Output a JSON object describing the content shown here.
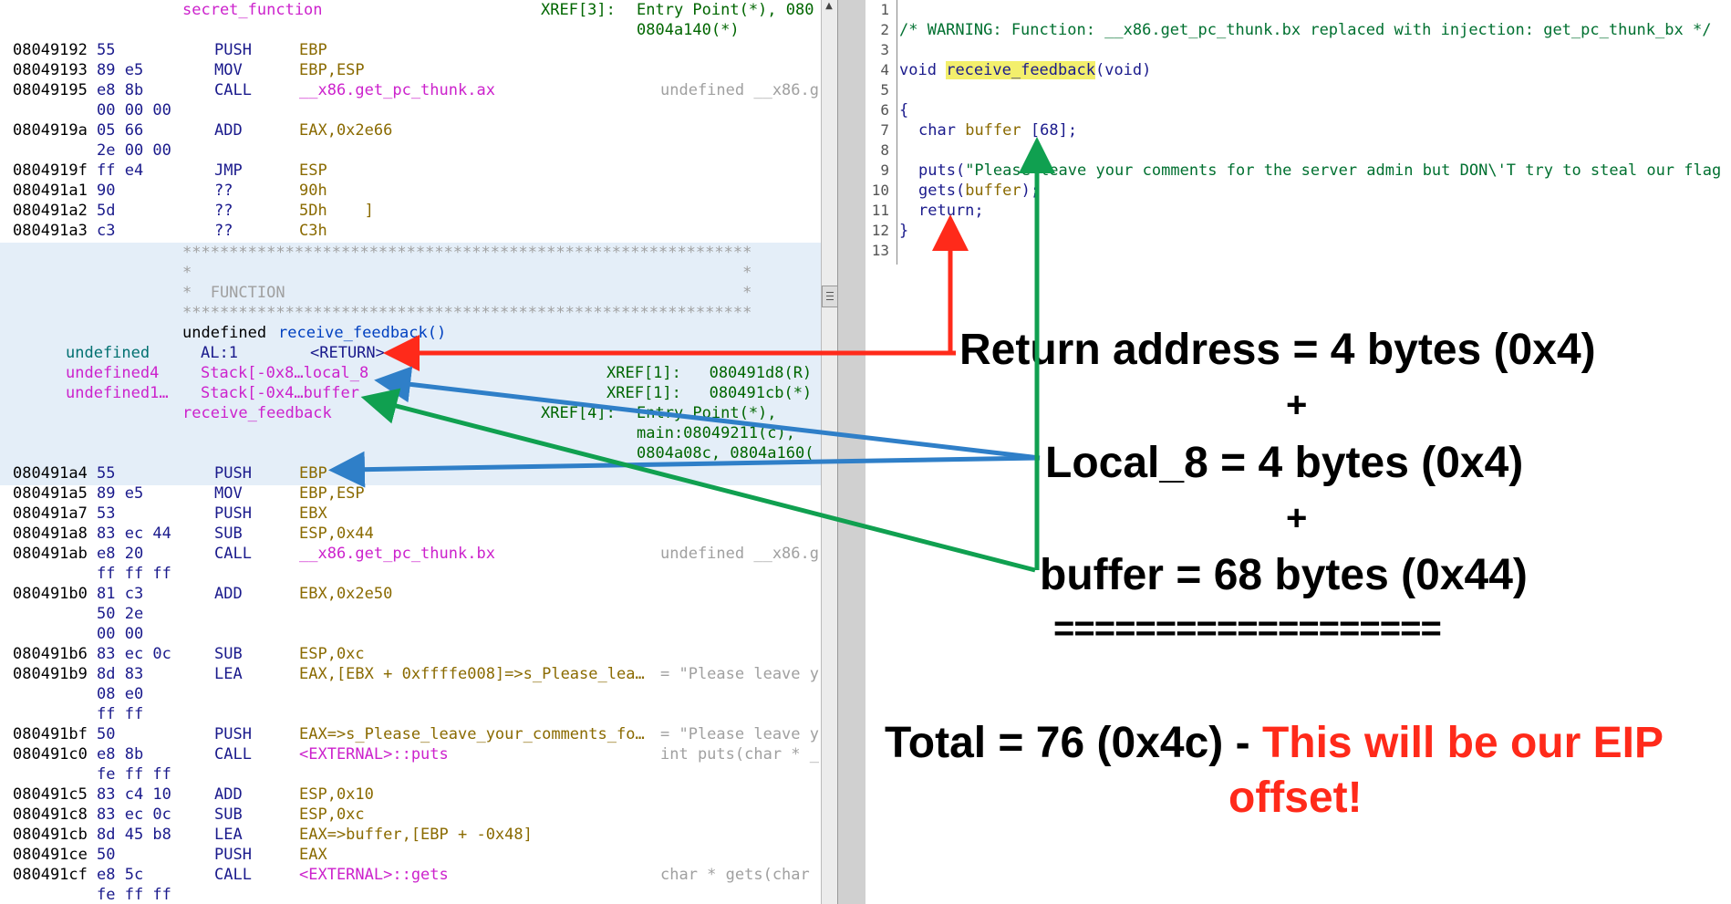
{
  "listing": {
    "header": {
      "func_name": "secret_function",
      "xref_label": "XREF[3]:",
      "xref_entry": "Entry Point(*), 080",
      "xref_cont": "0804a140(*)"
    },
    "rows_top": [
      {
        "addr": "08049192",
        "bytes": "55",
        "mnem": "PUSH",
        "op": "EBP"
      },
      {
        "addr": "08049193",
        "bytes": "89 e5",
        "mnem": "MOV",
        "op": "EBP,ESP"
      },
      {
        "addr": "08049195",
        "bytes": "e8 8b",
        "mnem": "CALL",
        "op": "__x86.get_pc_thunk.ax",
        "comment": "undefined __x86.g"
      },
      {
        "addr": "",
        "bytes": "00 00 00",
        "mnem": "",
        "op": ""
      },
      {
        "addr": "0804919a",
        "bytes": "05 66",
        "mnem": "ADD",
        "op": "EAX,0x2e66"
      },
      {
        "addr": "",
        "bytes": "2e 00 00",
        "mnem": "",
        "op": ""
      },
      {
        "addr": "0804919f",
        "bytes": "ff e4",
        "mnem": "JMP",
        "op": "ESP"
      },
      {
        "addr": "080491a1",
        "bytes": "90",
        "mnem": "??",
        "op": "90h"
      },
      {
        "addr": "080491a2",
        "bytes": "5d",
        "mnem": "??",
        "op": "5Dh    ]"
      },
      {
        "addr": "080491a3",
        "bytes": "c3",
        "mnem": "??",
        "op": "C3h"
      }
    ],
    "banner": {
      "stars": "*************************************************************",
      "side": "*                                                           *",
      "title": "*  FUNCTION                                                 *"
    },
    "signature": {
      "ret_type": "undefined",
      "name": "receive_feedback()"
    },
    "params": [
      {
        "type": "undefined",
        "loc": "AL:1",
        "name": "<RETURN>"
      },
      {
        "type": "undefined4",
        "loc": "Stack[-0x8…local_8",
        "name": "",
        "xref": "XREF[1]:   080491d8(R)"
      },
      {
        "type": "undefined1…",
        "loc": "Stack[-0x4…buffer",
        "name": "",
        "xref": "XREF[1]:   080491cb(*)"
      }
    ],
    "label": {
      "name": "receive_feedback",
      "xref_label": "XREF[4]:",
      "xref_1": "Entry Point(*),",
      "xref_2": "main:08049211(c),",
      "xref_3": "0804a08c, 0804a160("
    },
    "rows_bottom": [
      {
        "addr": "080491a4",
        "bytes": "55",
        "mnem": "PUSH",
        "op": "EBP"
      },
      {
        "addr": "080491a5",
        "bytes": "89 e5",
        "mnem": "MOV",
        "op": "EBP,ESP"
      },
      {
        "addr": "080491a7",
        "bytes": "53",
        "mnem": "PUSH",
        "op": "EBX"
      },
      {
        "addr": "080491a8",
        "bytes": "83 ec 44",
        "mnem": "SUB",
        "op": "ESP,0x44"
      },
      {
        "addr": "080491ab",
        "bytes": "e8 20",
        "mnem": "CALL",
        "op": "__x86.get_pc_thunk.bx",
        "comment": "undefined __x86.g"
      },
      {
        "addr": "",
        "bytes": "ff ff ff",
        "mnem": "",
        "op": ""
      },
      {
        "addr": "080491b0",
        "bytes": "81 c3",
        "mnem": "ADD",
        "op": "EBX,0x2e50"
      },
      {
        "addr": "",
        "bytes": "50 2e",
        "mnem": "",
        "op": ""
      },
      {
        "addr": "",
        "bytes": "00 00",
        "mnem": "",
        "op": ""
      },
      {
        "addr": "080491b6",
        "bytes": "83 ec 0c",
        "mnem": "SUB",
        "op": "ESP,0xc"
      },
      {
        "addr": "080491b9",
        "bytes": "8d 83",
        "mnem": "LEA",
        "op": "EAX,[EBX + 0xffffe008]=>s_Please_lea…",
        "comment": "= \"Please leave y"
      },
      {
        "addr": "",
        "bytes": "08 e0",
        "mnem": "",
        "op": ""
      },
      {
        "addr": "",
        "bytes": "ff ff",
        "mnem": "",
        "op": ""
      },
      {
        "addr": "080491bf",
        "bytes": "50",
        "mnem": "PUSH",
        "op": "EAX=>s_Please_leave_your_comments_fo…",
        "comment": "= \"Please leave y"
      },
      {
        "addr": "080491c0",
        "bytes": "e8 8b",
        "mnem": "CALL",
        "op": "<EXTERNAL>::puts",
        "comment": "int puts(char * _"
      },
      {
        "addr": "",
        "bytes": "fe ff ff",
        "mnem": "",
        "op": ""
      },
      {
        "addr": "080491c5",
        "bytes": "83 c4 10",
        "mnem": "ADD",
        "op": "ESP,0x10"
      },
      {
        "addr": "080491c8",
        "bytes": "83 ec 0c",
        "mnem": "SUB",
        "op": "ESP,0xc"
      },
      {
        "addr": "080491cb",
        "bytes": "8d 45 b8",
        "mnem": "LEA",
        "op": "EAX=>buffer,[EBP + -0x48]"
      },
      {
        "addr": "080491ce",
        "bytes": "50",
        "mnem": "PUSH",
        "op": "EAX"
      },
      {
        "addr": "080491cf",
        "bytes": "e8 5c",
        "mnem": "CALL",
        "op": "<EXTERNAL>::gets",
        "comment": "char * gets(char"
      },
      {
        "addr": "",
        "bytes": "fe ff ff",
        "mnem": "",
        "op": ""
      }
    ]
  },
  "decompiler": {
    "line_numbers": [
      "1",
      "2",
      "3",
      "4",
      "5",
      "6",
      "7",
      "8",
      "9",
      "10",
      "11",
      "12",
      "13"
    ],
    "warning": "/* WARNING: Function: __x86.get_pc_thunk.bx replaced with injection: get_pc_thunk_bx */",
    "sig_type": "void",
    "sig_name": "receive_feedback",
    "sig_params": "(void)",
    "open_brace": "{",
    "decl_type": "char",
    "decl_var": "buffer",
    "decl_size": "[68];",
    "puts_call": "puts(",
    "puts_str": "\"Please leave your comments for the server admin but DON\\'T try to steal our flag",
    "gets_call": "gets(",
    "gets_arg": "buffer",
    "gets_close": ");",
    "return_stmt": "return;",
    "close_brace": "}"
  },
  "annotation": {
    "line1": "Return address = 4 bytes (0x4)",
    "plus1": "+",
    "line2": "Local_8 = 4 bytes (0x4)",
    "plus2": "+",
    "line3": "buffer = 68 bytes (0x44)",
    "separator": "===================",
    "total_prefix": "Total = 76 (0x4c) - ",
    "total_highlight_1": "This will be our EIP",
    "total_highlight_2": "offset!"
  },
  "colors": {
    "arrow_red": "#ff2a1a",
    "arrow_blue": "#2f7fc8",
    "arrow_green": "#10a050",
    "highlight": "#f3ef6c",
    "function_block_bg": "#e4eef8"
  }
}
